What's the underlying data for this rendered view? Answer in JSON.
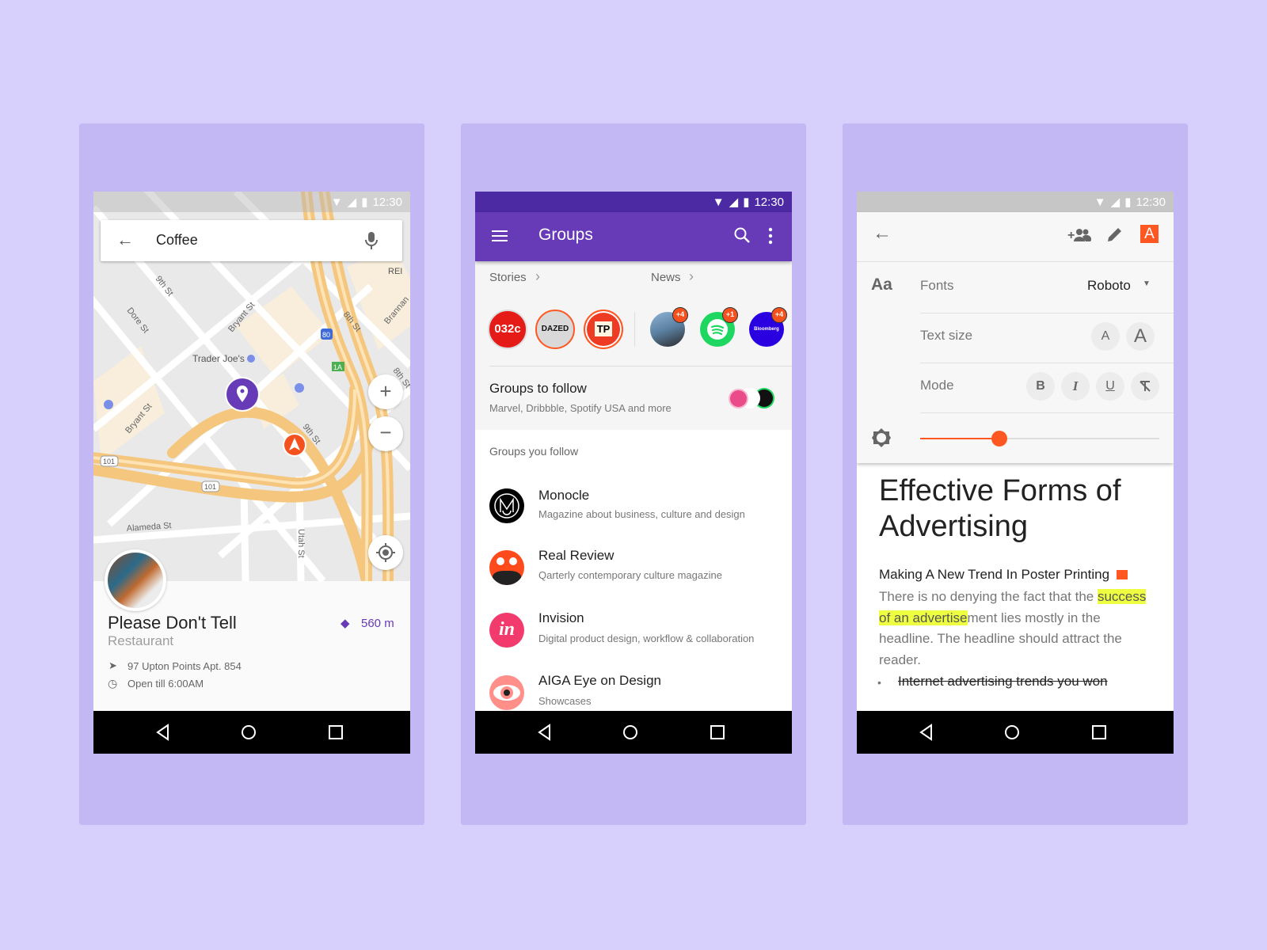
{
  "status": {
    "time": "12:30"
  },
  "maps": {
    "search_value": "Coffee",
    "labels": {
      "ninth_st": "9th St",
      "dore_st": "Dore St",
      "bryant_st": "Bryant St",
      "trader_joes": "Trader Joe's",
      "bryant_st_2": "Bryant St",
      "ninth_st_2": "9th St",
      "alameda_st": "Alameda St",
      "utah_st": "Utah St",
      "rei": "REI",
      "eighth_st": "8th St",
      "eighth_st_2": "8th St",
      "brannan": "Brannan",
      "i80": "80",
      "exit_1a": "1A",
      "us101_a": "101",
      "us101_b": "101"
    },
    "place": {
      "name": "Please Don't Tell",
      "type": "Restaurant",
      "distance": "560 m",
      "address": "97 Upton Points Apt. 854",
      "hours": "Open till 6:00AM"
    },
    "colors": {
      "accent": "#6739b6",
      "nav_marker": "#f4511e"
    }
  },
  "groups": {
    "title": "Groups",
    "stories_label": "Stories",
    "news_label": "News",
    "stories": [
      {
        "label": "032c",
        "color": "#e41b17"
      },
      {
        "label": "DAZED",
        "color": "#d9d9d9"
      },
      {
        "label": "TP",
        "color": "#ee3b24"
      }
    ],
    "news": [
      {
        "badge": "+4",
        "color": "#5a7fa0"
      },
      {
        "badge": "+1",
        "color": "#1ed760"
      },
      {
        "label": "Bloomberg",
        "badge": "+4",
        "color": "#2a00e0"
      }
    ],
    "to_follow": {
      "title": "Groups to follow",
      "subtitle": "Marvel, Dribbble, Spotify USA and more"
    },
    "you_follow_label": "Groups you follow",
    "items": [
      {
        "name": "Monocle",
        "desc": "Magazine about business, culture and design"
      },
      {
        "name": "Real Review",
        "desc": "Qarterly contemporary culture magazine"
      },
      {
        "name": "Invision",
        "desc": "Digital product design, workflow & collaboration",
        "logo": "in"
      },
      {
        "name": "AIGA Eye on Design",
        "desc": "Showcases"
      }
    ],
    "colors": {
      "status": "#4b2aa4",
      "appbar": "#673ab7"
    }
  },
  "editor": {
    "aa": "Aa",
    "fonts_label": "Fonts",
    "font_value": "Roboto",
    "text_size_label": "Text size",
    "size_small": "A",
    "size_large": "A",
    "mode_label": "Mode",
    "mode_bold": "B",
    "mode_italic": "I",
    "mode_underline": "U",
    "toolbar_badge": "A",
    "brightness": 0.33,
    "title": "Effective Forms of Advertising",
    "subheading": "Making A New Trend In Poster Printing",
    "para_before": "There is no denying the fact that the ",
    "para_highlight": "success of an advertise",
    "para_after": "ment lies mostly in the headline. The headline should attract the reader.",
    "bullet": "Internet advertising trends you won",
    "colors": {
      "accent": "#ff5722",
      "highlight": "#eeff41"
    }
  }
}
